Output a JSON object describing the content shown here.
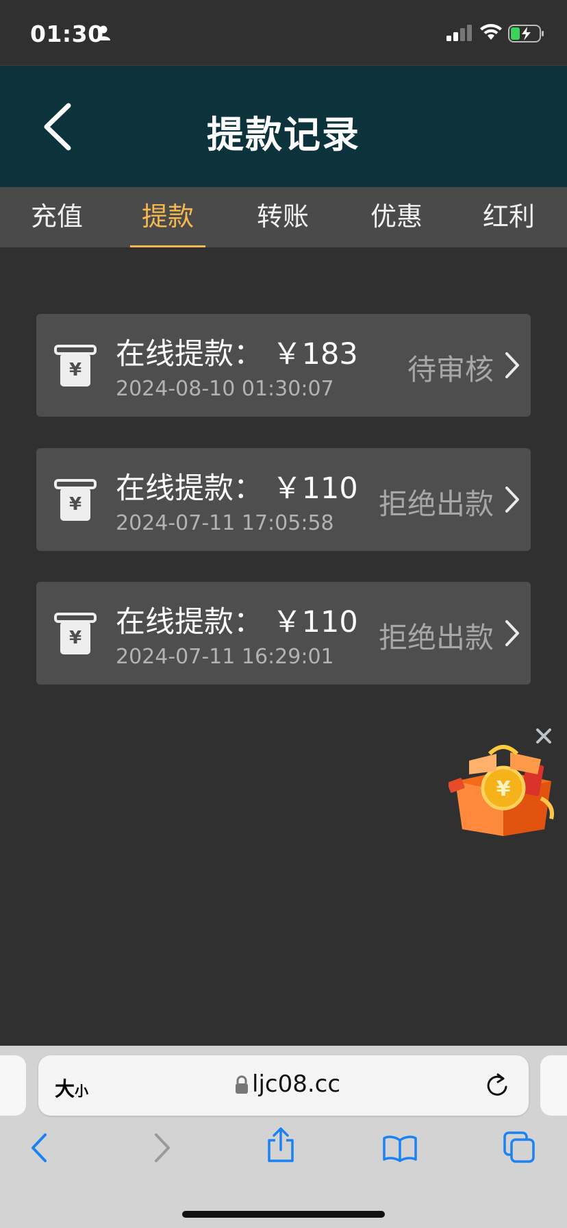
{
  "status_bar": {
    "time": "01:30"
  },
  "header": {
    "title": "提款记录"
  },
  "tabs": [
    {
      "label": "充值",
      "active": false
    },
    {
      "label": "提款",
      "active": true
    },
    {
      "label": "转账",
      "active": false
    },
    {
      "label": "优惠",
      "active": false
    },
    {
      "label": "红利",
      "active": false
    }
  ],
  "records": [
    {
      "title": "在线提款： ￥183",
      "date": "2024-08-10 01:30:07",
      "status": "待审核"
    },
    {
      "title": "在线提款： ￥110",
      "date": "2024-07-11 17:05:58",
      "status": "拒绝出款"
    },
    {
      "title": "在线提款： ￥110",
      "date": "2024-07-11 16:29:01",
      "status": "拒绝出款"
    }
  ],
  "browser": {
    "text_size_big": "大",
    "text_size_small": "小",
    "url": "ljc08.cc"
  },
  "colors": {
    "header_bg": "#0c333c",
    "tab_active": "#f4b84e",
    "page_bg": "#303030"
  }
}
